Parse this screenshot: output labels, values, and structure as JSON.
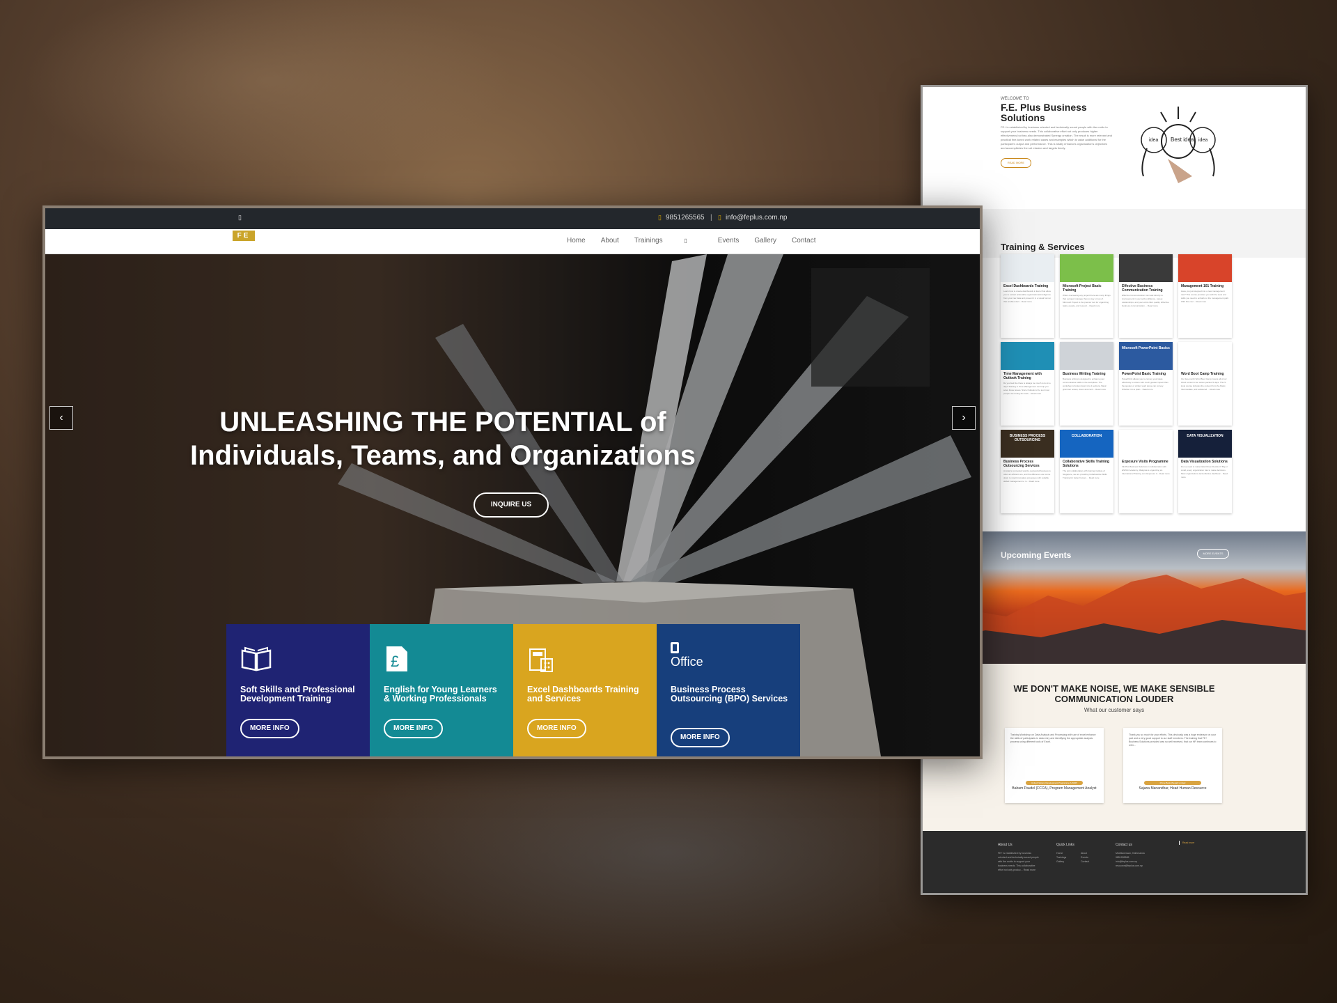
{
  "main": {
    "topbar": {
      "left_icon": "mobile-icon",
      "phone": "9851265565",
      "separator": "|",
      "email": "info@feplus.com.np"
    },
    "logo": "FE",
    "nav": [
      "Home",
      "About",
      "Trainings",
      "Events",
      "Gallery",
      "Contact"
    ],
    "hero": {
      "headline_1": "UNLEASHING THE POTENTIAL of",
      "headline_2": "Individuals, Teams, and Organizations",
      "button": "INQUIRE US",
      "prev": "‹",
      "next": "›"
    },
    "features": [
      {
        "title": "Soft Skills and Professional Development Training",
        "button": "MORE INFO",
        "color": "#1f2373",
        "icon": "book-icon"
      },
      {
        "title": "English for Young Learners & Working Professionals",
        "button": "MORE INFO",
        "color": "#138a94",
        "icon": "pound-document-icon"
      },
      {
        "title": "Excel Dashboards Training and Services",
        "button": "MORE INFO",
        "color": "#d9a51f",
        "icon": "calculator-icon"
      },
      {
        "title": "Business Process Outsourcing (BPO) Services",
        "button": "MORE INFO",
        "color": "#173f7c",
        "icon": "office-logo-icon",
        "icon_label": "Office"
      }
    ]
  },
  "page": {
    "welcome_small": "WELCOME TO",
    "welcome_title": "F.E. Plus Business Solutions",
    "welcome_text": "FE+ is established by business oriented and technically sound people with the motto to support your business needs. This collaborative effort not only produces higher effectiveness but has also demonstrated Synergy creation. The result is more relevant and practical fine-tuned work related cases and examples which is value additional for the participant's output and performance. This is totally enhances organization's objectives and accomplishes the set mission and targets timely.",
    "read_more": "READ MORE",
    "idea_words": [
      "idea",
      "Best idea",
      "idea"
    ],
    "services_title": "Training & Services",
    "services": [
      {
        "title": "Excel Dashboards Training",
        "text": "Learn how to create dashboards in Excel that allow you to extract actionable organizational intelligence from your raw data and present it in a visual format that enables deci... Read more",
        "thumb": "#e9eef2"
      },
      {
        "title": "Microsoft Project Basic Training",
        "text": "When overseeing any project there are many things that a project manager has to stay on top of. Microsoft Project is the premier tool for organizing tasks, people, and resourc... Read more",
        "thumb": "#7cbf4a"
      },
      {
        "title": "Effective Business Communication Training",
        "text": "Effective Communication can lead directly to improvement in your self-confidence, career, relationships, and your entire life's quality. Effective business communication ... Read more",
        "thumb": "#3a3a3a"
      },
      {
        "title": "Management 101 Training",
        "text": "Have you just stepped into a new management role? This course provides you with the tools and skills you need to embark on the management path. With this cour... Read more",
        "thumb": "#d8442a"
      },
      {
        "title": "Time Management with Outlook Training",
        "text": "Do you feel like there is always too much to do in a day? Training in Time Management can help you solve those issues. Since Outlook is the tool most people use during the work... Read more",
        "thumb": "#1f8fb5"
      },
      {
        "title": "Business Writing Training",
        "text": "Business writing is designed to enhance your communication skills in the workplace. The workshop is broken down into 4 sections. Basic grammar review, vision and contr... Read more",
        "thumb": "#cfd3d8"
      },
      {
        "title": "PowerPoint Basic Training",
        "text": "PowerPoint allows you to convey your ideas effectively to others with much greater impact than the spoken or written word alone can convey. Whether it is a plain... Read more",
        "thumb": "#2c5aa0",
        "thumb_text": "Microsoft PowerPoint Basics"
      },
      {
        "title": "Word Boot Camp Training",
        "text": "Our two-month Word Boot Camp covers all of our Word content in an action-packed 5 days. This 5-level course includes the content from the Basic, Intermediate, and advanced ... Read more",
        "thumb": ""
      },
      {
        "title": "Business Process Outsourcing Services",
        "text": "A today's connected world a successful business is often an efficient one, and the difference can come down to smart innovative processes with suitable skilled management to m... Read more",
        "thumb": "#3a2e20",
        "thumb_text": "BUSINESS PROCESS OUTSOURCING"
      },
      {
        "title": "Collaborative Skills Training Solutions",
        "text": "The joint collaboration with training institute of Singapore, we are providing Collaborative Skills Training for better human ... Read more",
        "thumb": "#1565c0",
        "thumb_text": "COLLABORATION"
      },
      {
        "title": "Exposure Visits Programme",
        "text": "FE Plus Business Solutions in collaboration with ESPAC Academy, Malaysia is organizing an International Training cum Exposure V... Read more",
        "thumb": ""
      },
      {
        "title": "Data Visualization Solutions",
        "text": "Do we need to make Data Driven Decision? Big or small, every organization has to make decisions. Most organizations lack effective dashboar... Read more",
        "thumb": "#15203a",
        "thumb_text": "DATA VISUALIZATION"
      }
    ],
    "events_title": "Upcoming Events",
    "events_button": "MORE EVENTS",
    "testimonial_title": "WE DON'T MAKE NOISE, WE MAKE SENSIBLE COMMUNICATION LOUDER",
    "testimonial_sub": "What our customer says",
    "testimonials": [
      {
        "text": "Training Workshop on Data Analysis and Processing with use of excel enhance the skills of participants in data entry and identifying the appropriate analysis process using different tools of Excel.",
        "org": "United Nations Development Programme (UNDP)",
        "name": "Balram Paudel (FCCA), Program Management Analyst"
      },
      {
        "text": "Thank you so much for your efforts. This obviously was a huge endeavor on your part and a very good support to our staff members. The training that FE+ Business Solutions provided was so well received, that our HR team continues to refer...",
        "org": "Prime Bank (Nepal) Limited",
        "name": "Sajana Manandhar, Head Human Resource"
      }
    ],
    "footer": {
      "about_title": "About Us",
      "about_text": "FE+ is established by business oriented and technically sound people with the motto to support your business needs. This collaborative effort not only produc... Read more",
      "links_title": "Quick Links",
      "links": [
        "Home",
        "Trainings",
        "Gallery",
        "About",
        "Events",
        "Contact"
      ],
      "contact_title": "Contact us",
      "contact": [
        "Mid-Baneswor, Kathmandu",
        "9851265565",
        "info@feplus.com.np",
        "resource@feplus.com.np"
      ],
      "extra": "Read more"
    }
  }
}
